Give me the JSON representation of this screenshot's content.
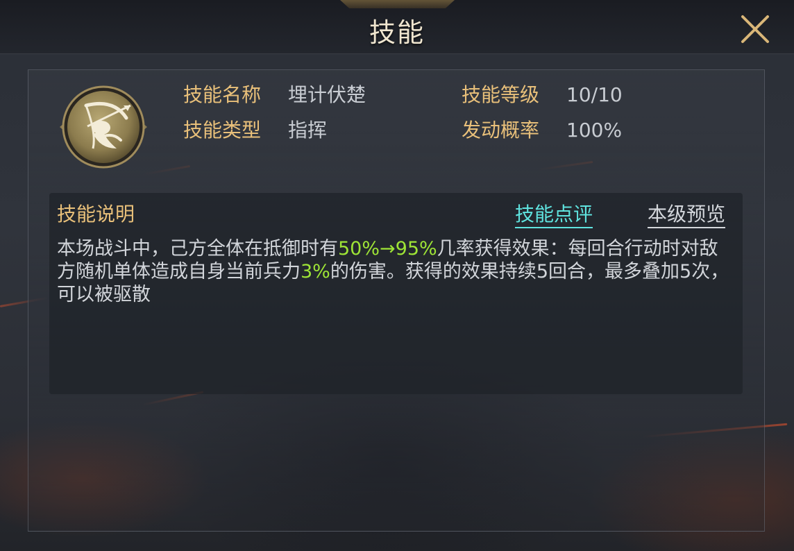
{
  "header": {
    "title": "技能"
  },
  "skill": {
    "name_label": "技能名称",
    "name_value": "埋计伏楚",
    "level_label": "技能等级",
    "level_value": "10/10",
    "type_label": "技能类型",
    "type_value": "指挥",
    "rate_label": "发动概率",
    "rate_value": "100%",
    "icon": "archer-emblem-icon"
  },
  "description": {
    "heading": "技能说明",
    "review_link": "技能点评",
    "preview_link": "本级预览",
    "segments": [
      {
        "text": "本场战斗中，己方全体在抵御时有",
        "highlight": false
      },
      {
        "text": "50%→95%",
        "highlight": true
      },
      {
        "text": "几率获得效果：每回合行动时对敌方随机单体造成自身当前兵力",
        "highlight": false
      },
      {
        "text": "3%",
        "highlight": true
      },
      {
        "text": "的伤害。获得的效果持续5回合，最多叠加5次，可以被驱散",
        "highlight": false
      }
    ]
  },
  "colors": {
    "label_gold": "#e9c07a",
    "highlight_green": "#9ee436",
    "link_cyan": "#5fe3df"
  }
}
